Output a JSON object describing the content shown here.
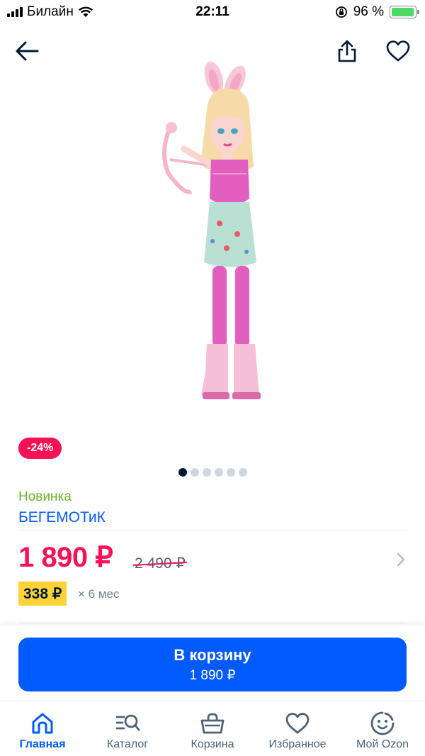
{
  "status_bar": {
    "carrier": "Билайн",
    "time": "22:11",
    "battery": "96 %"
  },
  "product": {
    "discount_badge": "-24%",
    "new_label": "Новинка",
    "brand": "БЕГЕМОТиК",
    "price_current": "1 890 ₽",
    "price_old": "2 490 ₽",
    "installment_price": "338 ₽",
    "installment_term": "× 6 мес",
    "gallery_index": 1,
    "gallery_total": 6
  },
  "cart_button": {
    "label": "В корзину",
    "price": "1 890 ₽"
  },
  "tab_bar": {
    "items": [
      {
        "label": "Главная",
        "icon": "home-icon"
      },
      {
        "label": "Каталог",
        "icon": "catalog-search-icon"
      },
      {
        "label": "Корзина",
        "icon": "basket-icon"
      },
      {
        "label": "Избранное",
        "icon": "heart-icon"
      },
      {
        "label": "Мой Ozon",
        "icon": "smiley-icon"
      }
    ]
  },
  "colors": {
    "accent": "#005bff",
    "sale": "#f91155",
    "new": "#6bb32a",
    "installment": "#ffd338"
  }
}
